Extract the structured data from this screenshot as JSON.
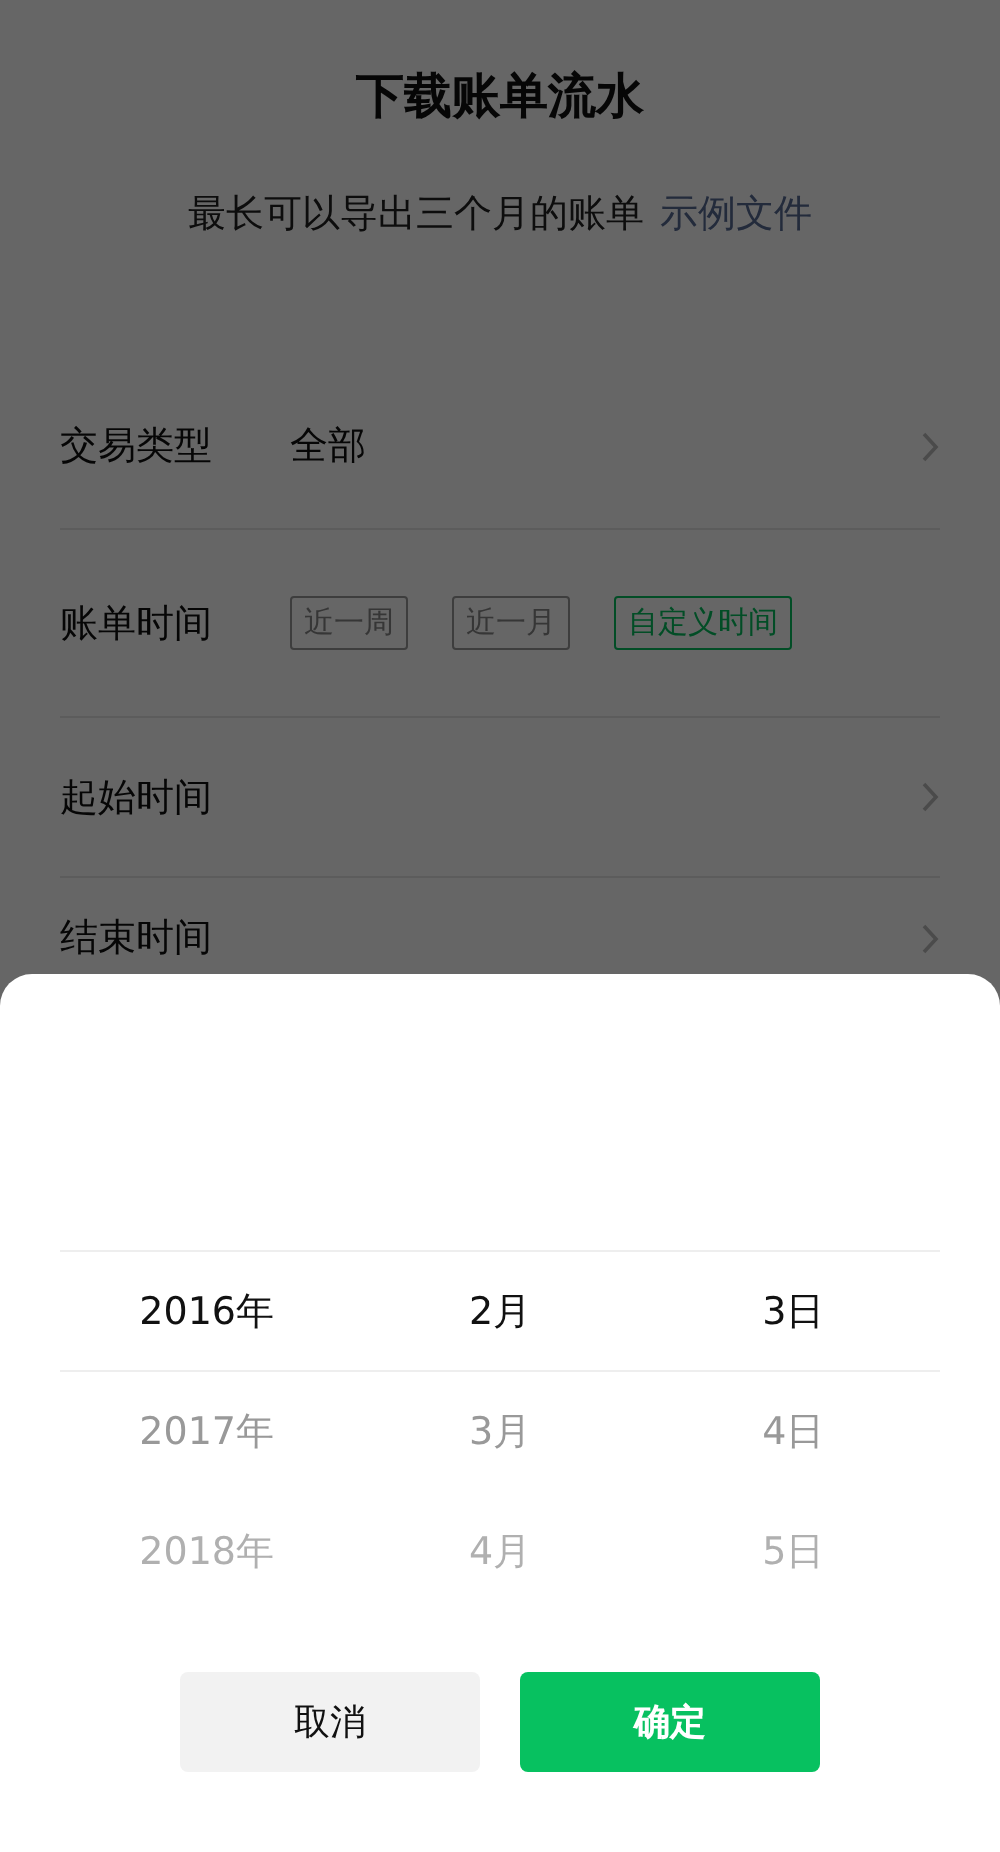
{
  "title": "下载账单流水",
  "subtitle": {
    "text": "最长可以导出三个月的账单",
    "link": "示例文件"
  },
  "rows": [
    {
      "kind": "value",
      "label": "交易类型",
      "value": "全部",
      "chevron": true
    },
    {
      "kind": "chips",
      "label": "账单时间",
      "chips": [
        {
          "label": "近一周",
          "selected": false
        },
        {
          "label": "近一月",
          "selected": false
        },
        {
          "label": "自定义时间",
          "selected": true
        }
      ]
    },
    {
      "kind": "value",
      "label": "起始时间",
      "chevron": true
    },
    {
      "kind": "value",
      "label": "结束时间",
      "chevron": true
    }
  ],
  "picker": {
    "columns": [
      {
        "items": [
          {
            "label": "2016年",
            "selected": true
          },
          {
            "label": "2017年",
            "selected": false
          },
          {
            "label": "2018年",
            "selected": false
          }
        ]
      },
      {
        "items": [
          {
            "label": "2月",
            "selected": true
          },
          {
            "label": "3月",
            "selected": false
          },
          {
            "label": "4月",
            "selected": false
          }
        ]
      },
      {
        "items": [
          {
            "label": "3日",
            "selected": true
          },
          {
            "label": "4日",
            "selected": false
          },
          {
            "label": "5日",
            "selected": false
          }
        ]
      }
    ],
    "buttons": [
      {
        "kind": "cancel",
        "label": "取消"
      },
      {
        "kind": "confirm",
        "label": "确定"
      }
    ]
  }
}
